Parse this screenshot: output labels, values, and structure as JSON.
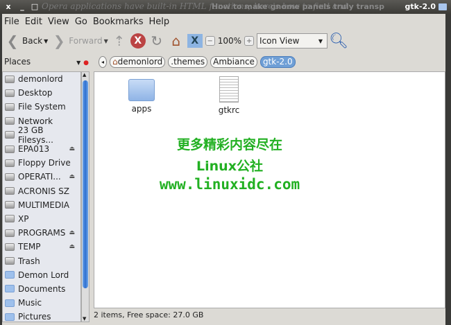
{
  "topbar": {
    "bg_text": "Opera applications have built-in HTML functions; here's how to find and",
    "bg_text2": "How to make gnome panels truly transp",
    "title": "gtk-2.0",
    "close": "x",
    "min": "_",
    "max": "□"
  },
  "menu": [
    "File",
    "Edit",
    "View",
    "Go",
    "Bookmarks",
    "Help"
  ],
  "toolbar": {
    "back": "Back",
    "forward": "Forward",
    "zoom": "100%",
    "view": "Icon View"
  },
  "location": {
    "places": "Places",
    "crumbs": [
      "demonlord",
      ".themes",
      "Ambiance",
      "gtk-2.0"
    ]
  },
  "sidebar": [
    {
      "label": "demonlord",
      "icon": "home-icon"
    },
    {
      "label": "Desktop",
      "icon": "desktop-icon"
    },
    {
      "label": "File System",
      "icon": "drive-icon"
    },
    {
      "label": "Network",
      "icon": "network-icon"
    },
    {
      "label": "23 GB Filesys...",
      "icon": "drive-icon"
    },
    {
      "label": "EPA013",
      "icon": "cd-icon",
      "eject": true
    },
    {
      "label": "Floppy Drive",
      "icon": "floppy-icon"
    },
    {
      "label": "OPERATI...",
      "icon": "drive-icon",
      "eject": true
    },
    {
      "label": "ACRONIS SZ",
      "icon": "drive-icon"
    },
    {
      "label": "MULTIMEDIA",
      "icon": "drive-icon"
    },
    {
      "label": "XP",
      "icon": "drive-icon"
    },
    {
      "label": "PROGRAMS",
      "icon": "drive-icon",
      "eject": true
    },
    {
      "label": "TEMP",
      "icon": "drive-icon",
      "eject": true
    },
    {
      "label": "Trash",
      "icon": "trash-icon"
    },
    {
      "label": "Demon Lord",
      "icon": "folder-icon"
    },
    {
      "label": "Documents",
      "icon": "folder-icon"
    },
    {
      "label": "Music",
      "icon": "folder-icon"
    },
    {
      "label": "Pictures",
      "icon": "folder-icon"
    }
  ],
  "files": [
    {
      "name": "apps",
      "icon": "folder-icon"
    },
    {
      "name": "gtkrc",
      "icon": "text-file-icon"
    }
  ],
  "watermark": [
    "更多精彩内容尽在",
    "Linux公社",
    "www.linuxidc.com"
  ],
  "status": "2 items, Free space: 27.0 GB",
  "colors": {
    "accent": "#6f9fd6",
    "watermark": "#22b022"
  }
}
